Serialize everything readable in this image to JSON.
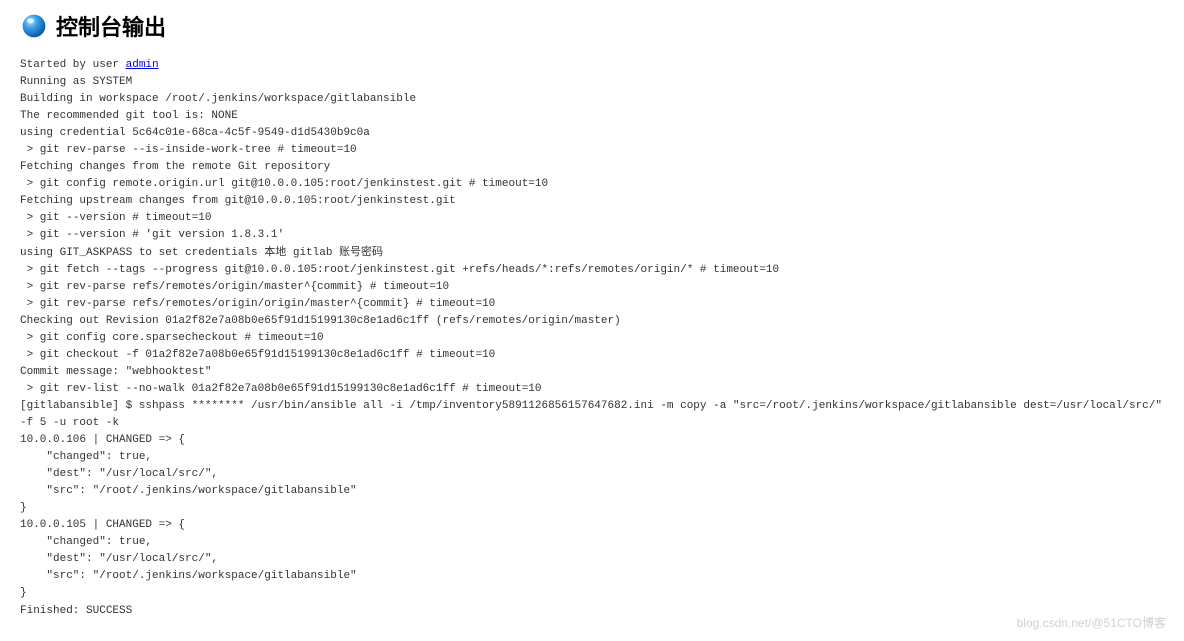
{
  "header": {
    "title": "控制台输出"
  },
  "user_link": "admin",
  "lines": [
    {
      "t": "Started by user ",
      "link": "admin"
    },
    {
      "t": "Running as SYSTEM"
    },
    {
      "t": "Building in workspace /root/.jenkins/workspace/gitlabansible"
    },
    {
      "t": "The recommended git tool is: NONE"
    },
    {
      "t": "using credential 5c64c01e-68ca-4c5f-9549-d1d5430b9c0a"
    },
    {
      "t": " > git rev-parse --is-inside-work-tree # timeout=10"
    },
    {
      "t": "Fetching changes from the remote Git repository"
    },
    {
      "t": " > git config remote.origin.url git@10.0.0.105:root/jenkinstest.git # timeout=10"
    },
    {
      "t": "Fetching upstream changes from git@10.0.0.105:root/jenkinstest.git"
    },
    {
      "t": " > git --version # timeout=10"
    },
    {
      "t": " > git --version # 'git version 1.8.3.1'"
    },
    {
      "t": "using GIT_ASKPASS to set credentials 本地 gitlab 账号密码"
    },
    {
      "t": " > git fetch --tags --progress git@10.0.0.105:root/jenkinstest.git +refs/heads/*:refs/remotes/origin/* # timeout=10"
    },
    {
      "t": " > git rev-parse refs/remotes/origin/master^{commit} # timeout=10"
    },
    {
      "t": " > git rev-parse refs/remotes/origin/origin/master^{commit} # timeout=10"
    },
    {
      "t": "Checking out Revision 01a2f82e7a08b0e65f91d15199130c8e1ad6c1ff (refs/remotes/origin/master)"
    },
    {
      "t": " > git config core.sparsecheckout # timeout=10"
    },
    {
      "t": " > git checkout -f 01a2f82e7a08b0e65f91d15199130c8e1ad6c1ff # timeout=10"
    },
    {
      "t": "Commit message: \"webhooktest\""
    },
    {
      "t": " > git rev-list --no-walk 01a2f82e7a08b0e65f91d15199130c8e1ad6c1ff # timeout=10"
    },
    {
      "t": "[gitlabansible] $ sshpass ******** /usr/bin/ansible all -i /tmp/inventory5891126856157647682.ini -m copy -a \"src=/root/.jenkins/workspace/gitlabansible dest=/usr/local/src/\" -f 5 -u root -k"
    },
    {
      "t": "10.0.0.106 | CHANGED => {"
    },
    {
      "t": "    \"changed\": true,"
    },
    {
      "t": "    \"dest\": \"/usr/local/src/\","
    },
    {
      "t": "    \"src\": \"/root/.jenkins/workspace/gitlabansible\""
    },
    {
      "t": "}"
    },
    {
      "t": "10.0.0.105 | CHANGED => {"
    },
    {
      "t": "    \"changed\": true,"
    },
    {
      "t": "    \"dest\": \"/usr/local/src/\","
    },
    {
      "t": "    \"src\": \"/root/.jenkins/workspace/gitlabansible\""
    },
    {
      "t": "}"
    },
    {
      "t": "Finished: SUCCESS"
    }
  ],
  "watermark": "blog.csdn.net/@51CTO博客"
}
